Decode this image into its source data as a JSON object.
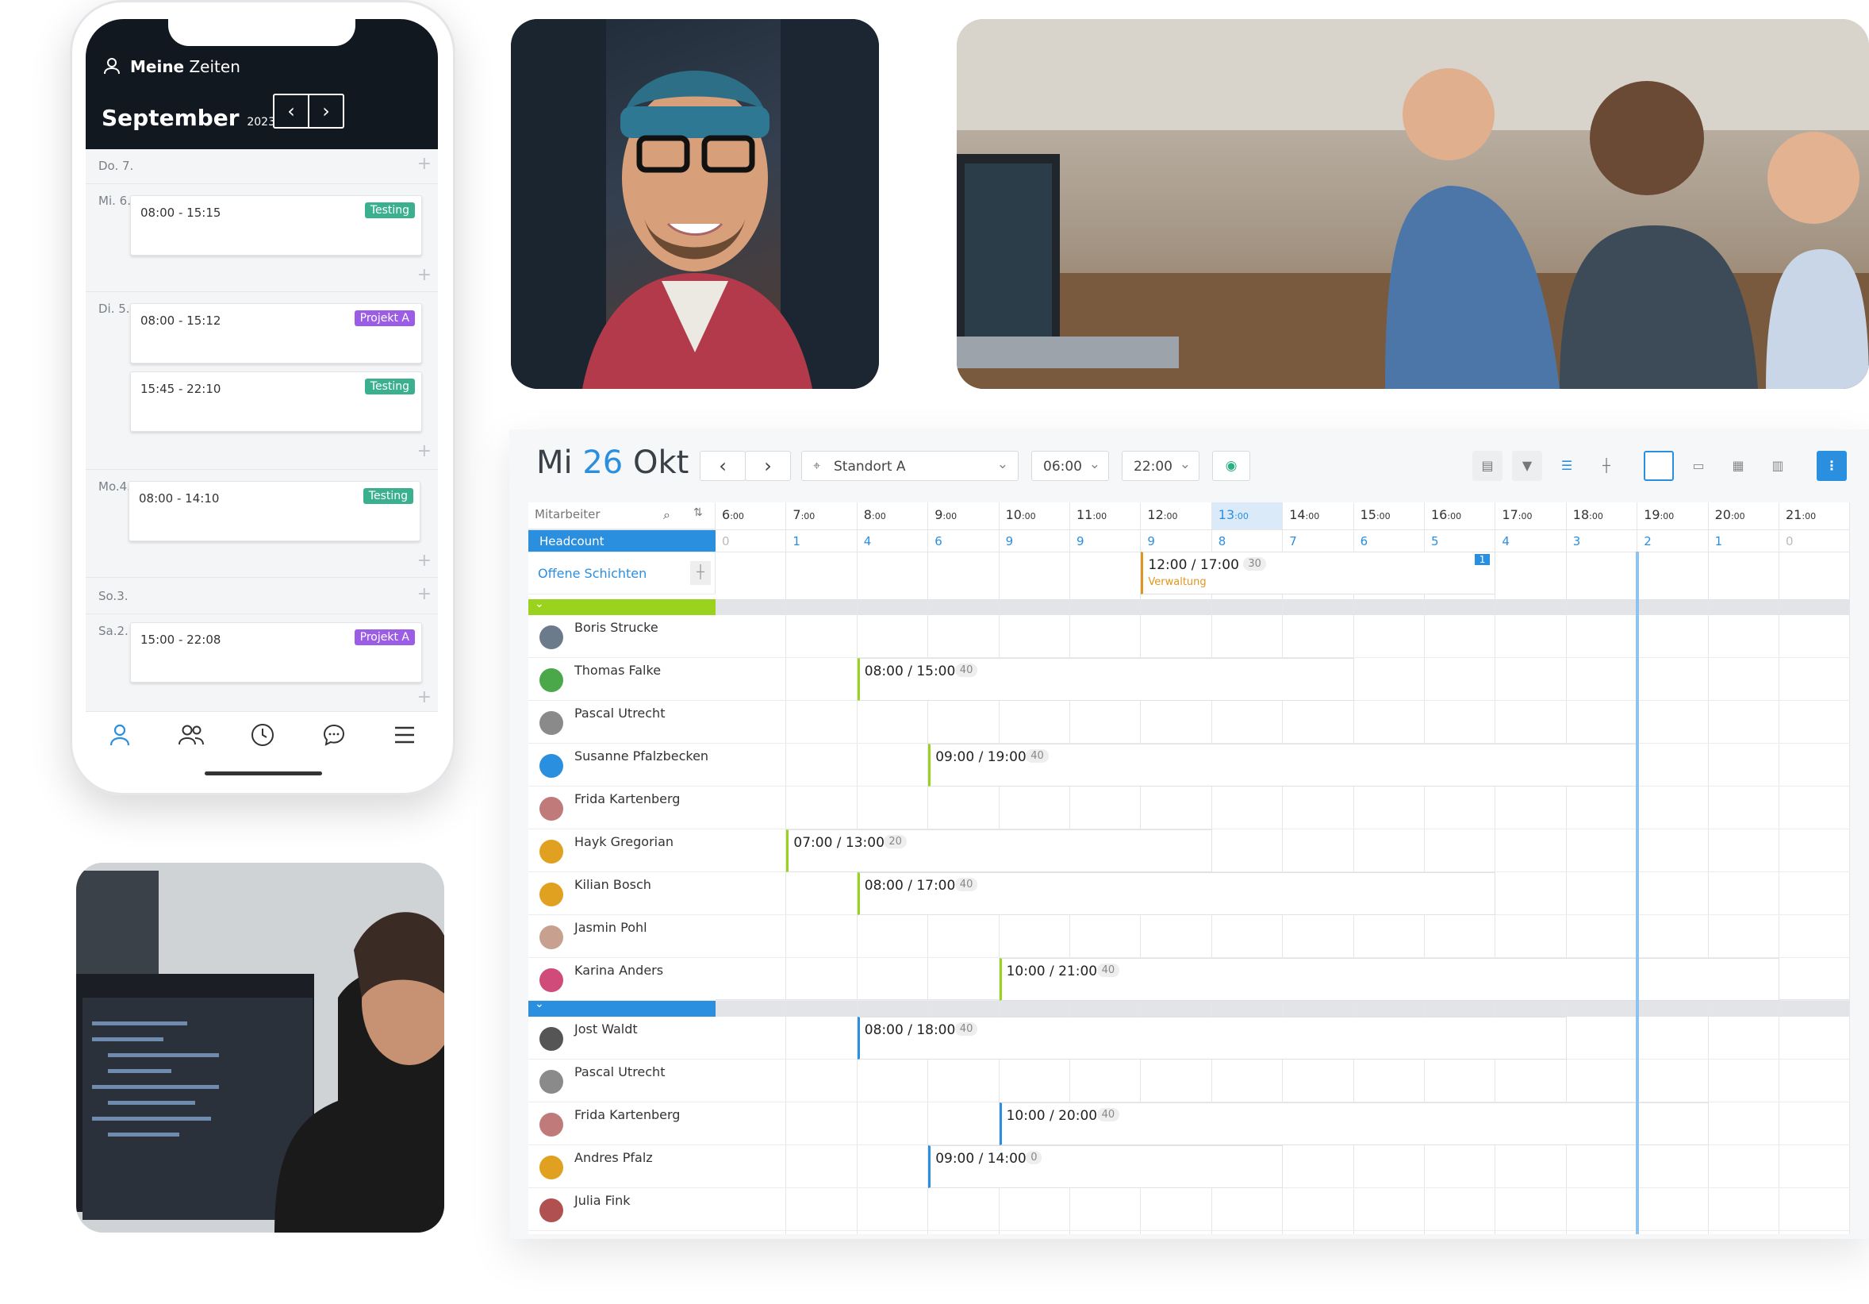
{
  "phone": {
    "header_title_bold": "Meine",
    "header_title_rest": "Zeiten",
    "month": "September",
    "year": "2023",
    "days": [
      {
        "label": "Do. 7.",
        "shifts": []
      },
      {
        "label": "Mi. 6.",
        "shifts": [
          {
            "time": "08:00 - 15:15",
            "tag": "Testing"
          }
        ]
      },
      {
        "label": "Di. 5.",
        "shifts": [
          {
            "time": "08:00 - 15:12",
            "tag": "Projekt A"
          },
          {
            "time": "15:45 - 22:10",
            "tag": "Testing"
          }
        ]
      },
      {
        "label": "Mo.4.",
        "shifts": [
          {
            "time": "08:00 - 14:10",
            "tag": "Testing"
          }
        ]
      },
      {
        "label": "So.3.",
        "shifts": []
      },
      {
        "label": "Sa.2.",
        "shifts": [
          {
            "time": "15:00 - 22:08",
            "tag": "Projekt A"
          }
        ]
      }
    ],
    "colors": {
      "testing": "#3bb08f",
      "projekt": "#9b5de5",
      "nav_active": "#2b8fe0"
    }
  },
  "planner": {
    "date_day": "Mi",
    "date_num": "26",
    "date_month": "Okt",
    "location": "Standort A",
    "start": "06:00",
    "end": "22:00",
    "search_placeholder": "Mitarbeiter",
    "headcount_label": "Headcount",
    "open_label": "Offene Schichten",
    "hours": [
      "6",
      "7",
      "8",
      "9",
      "10",
      "11",
      "12",
      "13",
      "14",
      "15",
      "16",
      "17",
      "18",
      "19",
      "20",
      "21"
    ],
    "headcount": [
      "0",
      "1",
      "4",
      "6",
      "9",
      "9",
      "9",
      "8",
      "7",
      "6",
      "5",
      "4",
      "3",
      "2",
      "1",
      "0"
    ],
    "open_shift": {
      "time": "12:00 / 17:00",
      "num": "30",
      "label": "Verwaltung",
      "badge": "1"
    },
    "group1": [
      {
        "name": "Boris Strucke"
      },
      {
        "name": "Thomas Falke",
        "shift": "08:00 / 15:00",
        "num": "40"
      },
      {
        "name": "Pascal Utrecht"
      },
      {
        "name": "Susanne Pfalzbecken",
        "shift": "09:00 / 19:00",
        "num": "40"
      },
      {
        "name": "Frida Kartenberg"
      },
      {
        "name": "Hayk Gregorian",
        "shift": "07:00 / 13:00",
        "num": "20"
      },
      {
        "name": "Kilian Bosch",
        "shift": "08:00 / 17:00",
        "num": "40"
      },
      {
        "name": "Jasmin Pohl"
      },
      {
        "name": "Karina Anders",
        "shift": "10:00 / 21:00",
        "num": "40"
      }
    ],
    "group2": [
      {
        "name": "Jost Waldt",
        "shift": "08:00 / 18:00",
        "num": "40"
      },
      {
        "name": "Pascal Utrecht"
      },
      {
        "name": "Frida Kartenberg",
        "shift": "10:00 / 20:00",
        "num": "40"
      },
      {
        "name": "Andres Pfalz",
        "shift": "09:00 / 14:00",
        "num": "0"
      },
      {
        "name": "Julia Fink"
      }
    ],
    "colors": {
      "accent": "#2b8fe0",
      "group1": "#9ad31e",
      "group2": "#2b8fe0",
      "now_line": "#8ec3f0",
      "open_text": "#e0961e"
    }
  }
}
